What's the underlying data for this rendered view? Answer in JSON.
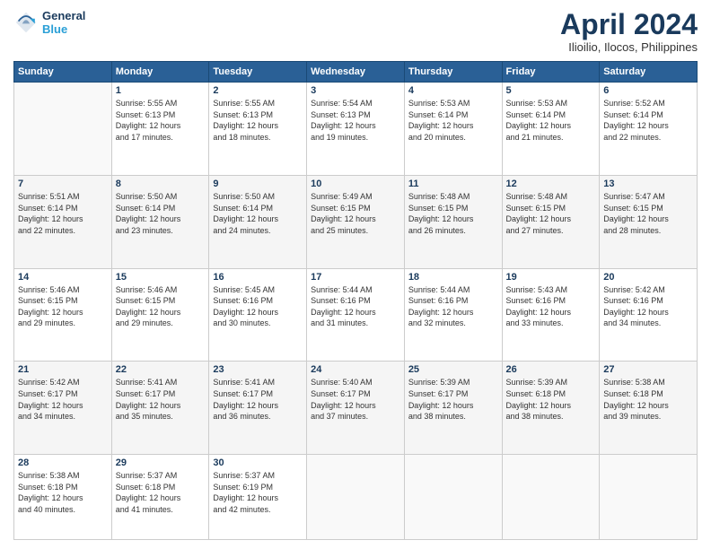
{
  "logo": {
    "line1": "General",
    "line2": "Blue"
  },
  "title": "April 2024",
  "subtitle": "Ilioilio, Ilocos, Philippines",
  "days_of_week": [
    "Sunday",
    "Monday",
    "Tuesday",
    "Wednesday",
    "Thursday",
    "Friday",
    "Saturday"
  ],
  "weeks": [
    [
      {
        "day": "",
        "info": ""
      },
      {
        "day": "1",
        "info": "Sunrise: 5:55 AM\nSunset: 6:13 PM\nDaylight: 12 hours\nand 17 minutes."
      },
      {
        "day": "2",
        "info": "Sunrise: 5:55 AM\nSunset: 6:13 PM\nDaylight: 12 hours\nand 18 minutes."
      },
      {
        "day": "3",
        "info": "Sunrise: 5:54 AM\nSunset: 6:13 PM\nDaylight: 12 hours\nand 19 minutes."
      },
      {
        "day": "4",
        "info": "Sunrise: 5:53 AM\nSunset: 6:14 PM\nDaylight: 12 hours\nand 20 minutes."
      },
      {
        "day": "5",
        "info": "Sunrise: 5:53 AM\nSunset: 6:14 PM\nDaylight: 12 hours\nand 21 minutes."
      },
      {
        "day": "6",
        "info": "Sunrise: 5:52 AM\nSunset: 6:14 PM\nDaylight: 12 hours\nand 22 minutes."
      }
    ],
    [
      {
        "day": "7",
        "info": "Sunrise: 5:51 AM\nSunset: 6:14 PM\nDaylight: 12 hours\nand 22 minutes."
      },
      {
        "day": "8",
        "info": "Sunrise: 5:50 AM\nSunset: 6:14 PM\nDaylight: 12 hours\nand 23 minutes."
      },
      {
        "day": "9",
        "info": "Sunrise: 5:50 AM\nSunset: 6:14 PM\nDaylight: 12 hours\nand 24 minutes."
      },
      {
        "day": "10",
        "info": "Sunrise: 5:49 AM\nSunset: 6:15 PM\nDaylight: 12 hours\nand 25 minutes."
      },
      {
        "day": "11",
        "info": "Sunrise: 5:48 AM\nSunset: 6:15 PM\nDaylight: 12 hours\nand 26 minutes."
      },
      {
        "day": "12",
        "info": "Sunrise: 5:48 AM\nSunset: 6:15 PM\nDaylight: 12 hours\nand 27 minutes."
      },
      {
        "day": "13",
        "info": "Sunrise: 5:47 AM\nSunset: 6:15 PM\nDaylight: 12 hours\nand 28 minutes."
      }
    ],
    [
      {
        "day": "14",
        "info": "Sunrise: 5:46 AM\nSunset: 6:15 PM\nDaylight: 12 hours\nand 29 minutes."
      },
      {
        "day": "15",
        "info": "Sunrise: 5:46 AM\nSunset: 6:15 PM\nDaylight: 12 hours\nand 29 minutes."
      },
      {
        "day": "16",
        "info": "Sunrise: 5:45 AM\nSunset: 6:16 PM\nDaylight: 12 hours\nand 30 minutes."
      },
      {
        "day": "17",
        "info": "Sunrise: 5:44 AM\nSunset: 6:16 PM\nDaylight: 12 hours\nand 31 minutes."
      },
      {
        "day": "18",
        "info": "Sunrise: 5:44 AM\nSunset: 6:16 PM\nDaylight: 12 hours\nand 32 minutes."
      },
      {
        "day": "19",
        "info": "Sunrise: 5:43 AM\nSunset: 6:16 PM\nDaylight: 12 hours\nand 33 minutes."
      },
      {
        "day": "20",
        "info": "Sunrise: 5:42 AM\nSunset: 6:16 PM\nDaylight: 12 hours\nand 34 minutes."
      }
    ],
    [
      {
        "day": "21",
        "info": "Sunrise: 5:42 AM\nSunset: 6:17 PM\nDaylight: 12 hours\nand 34 minutes."
      },
      {
        "day": "22",
        "info": "Sunrise: 5:41 AM\nSunset: 6:17 PM\nDaylight: 12 hours\nand 35 minutes."
      },
      {
        "day": "23",
        "info": "Sunrise: 5:41 AM\nSunset: 6:17 PM\nDaylight: 12 hours\nand 36 minutes."
      },
      {
        "day": "24",
        "info": "Sunrise: 5:40 AM\nSunset: 6:17 PM\nDaylight: 12 hours\nand 37 minutes."
      },
      {
        "day": "25",
        "info": "Sunrise: 5:39 AM\nSunset: 6:17 PM\nDaylight: 12 hours\nand 38 minutes."
      },
      {
        "day": "26",
        "info": "Sunrise: 5:39 AM\nSunset: 6:18 PM\nDaylight: 12 hours\nand 38 minutes."
      },
      {
        "day": "27",
        "info": "Sunrise: 5:38 AM\nSunset: 6:18 PM\nDaylight: 12 hours\nand 39 minutes."
      }
    ],
    [
      {
        "day": "28",
        "info": "Sunrise: 5:38 AM\nSunset: 6:18 PM\nDaylight: 12 hours\nand 40 minutes."
      },
      {
        "day": "29",
        "info": "Sunrise: 5:37 AM\nSunset: 6:18 PM\nDaylight: 12 hours\nand 41 minutes."
      },
      {
        "day": "30",
        "info": "Sunrise: 5:37 AM\nSunset: 6:19 PM\nDaylight: 12 hours\nand 42 minutes."
      },
      {
        "day": "",
        "info": ""
      },
      {
        "day": "",
        "info": ""
      },
      {
        "day": "",
        "info": ""
      },
      {
        "day": "",
        "info": ""
      }
    ]
  ]
}
